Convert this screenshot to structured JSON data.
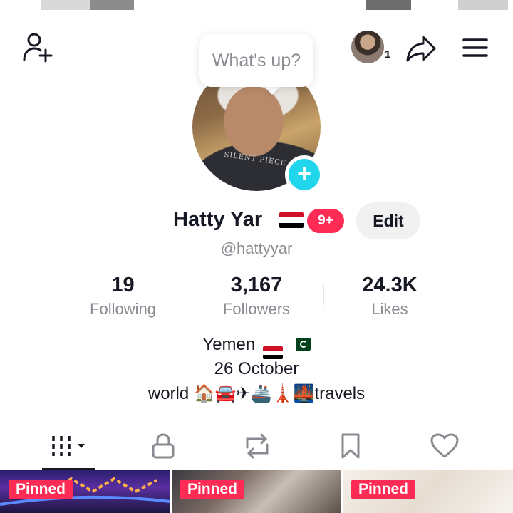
{
  "header": {
    "story_count": "1",
    "bubble_text": "What's up?"
  },
  "profile": {
    "shirt_text": "SILENT PIECE",
    "name": "Hatty Yar",
    "badge": "9+",
    "edit_label": "Edit",
    "handle": "@hattyyar"
  },
  "stats": [
    {
      "value": "19",
      "label": "Following"
    },
    {
      "value": "3,167",
      "label": "Followers"
    },
    {
      "value": "24.3K",
      "label": "Likes"
    }
  ],
  "bio": {
    "line1": "Yemen",
    "line2": "26 October",
    "line3_prefix": "world ",
    "line3_emoji": "🏠🚘✈🚢🗼🌉",
    "line3_suffix": "travels"
  },
  "tabs": [
    "videos",
    "private",
    "reposts",
    "favorites",
    "liked"
  ],
  "grid": [
    {
      "label": "Pinned"
    },
    {
      "label": "Pinned"
    },
    {
      "label": "Pinned"
    }
  ],
  "colors": {
    "accent_red": "#fe2c55",
    "accent_cyan": "#20d5ec",
    "text_primary": "#161823",
    "text_secondary": "#8a8b91"
  }
}
